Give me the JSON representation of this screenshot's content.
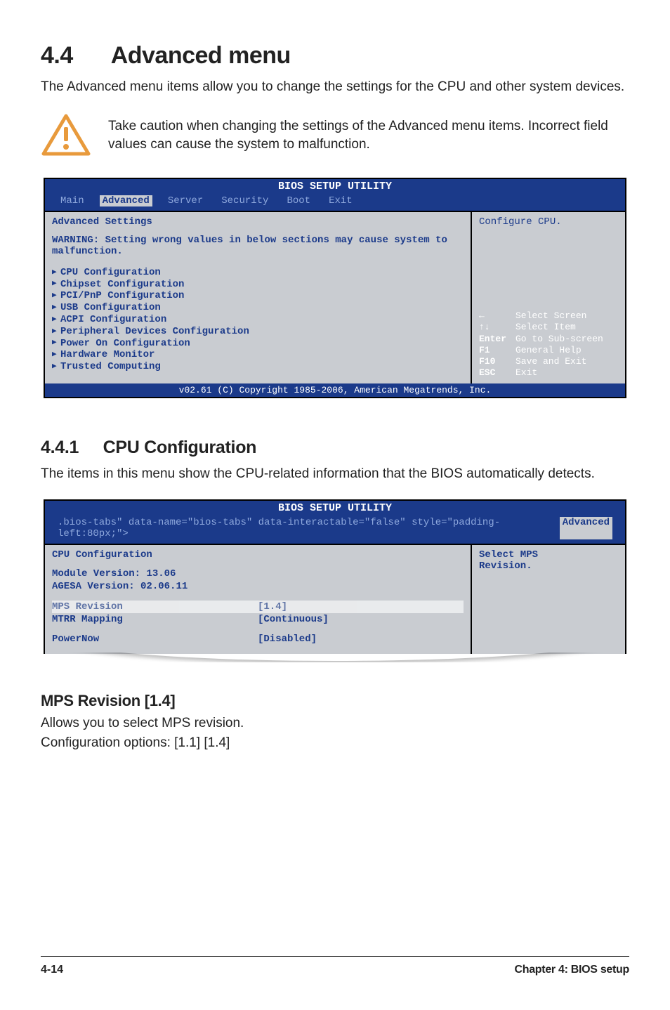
{
  "heading": {
    "num": "4.4",
    "title": "Advanced menu"
  },
  "intro": "The Advanced menu items allow you to change the settings for the CPU and other system devices.",
  "caution": "Take caution when changing the settings of the Advanced menu items. Incorrect field values can cause the system to malfunction.",
  "bios1": {
    "title": "BIOS SETUP UTILITY",
    "tabs": [
      "Main",
      "Advanced",
      "Server",
      "Security",
      "Boot",
      "Exit"
    ],
    "section_title": "Advanced Settings",
    "warning": "WARNING: Setting wrong values in below sections may cause system to malfunction.",
    "items": [
      "CPU Configuration",
      "Chipset Configuration",
      "PCI/PnP Configuration",
      "USB Configuration",
      "ACPI Configuration",
      "Peripheral Devices Configuration",
      "Power On Configuration",
      "Hardware Monitor",
      "Trusted Computing"
    ],
    "help_top": "Configure CPU.",
    "nav": [
      {
        "key": "←",
        "label": "Select Screen"
      },
      {
        "key": "↑↓",
        "label": "Select Item"
      },
      {
        "key": "Enter",
        "label": "Go to Sub-screen"
      },
      {
        "key": "F1",
        "label": "General Help"
      },
      {
        "key": "F10",
        "label": "Save and Exit"
      },
      {
        "key": "ESC",
        "label": "Exit"
      }
    ],
    "footer": "v02.61 (C) Copyright 1985-2006, American Megatrends, Inc."
  },
  "sub": {
    "num": "4.4.1",
    "title": "CPU Configuration"
  },
  "sub_intro": "The items in this menu show the CPU-related information that the BIOS automatically detects.",
  "bios2": {
    "title": "BIOS SETUP UTILITY",
    "tab": "Advanced",
    "section_title": "CPU Configuration",
    "module_ver_label": "Module Version:",
    "module_ver": "13.06",
    "agesa_ver_label": "AGESA Version:",
    "agesa_ver": "02.06.11",
    "rows": [
      {
        "name": "MPS Revision",
        "value": "[1.4]",
        "selected": true
      },
      {
        "name": "MTRR Mapping",
        "value": "[Continuous]",
        "selected": false
      },
      {
        "name": "PowerNow",
        "value": "[Disabled]",
        "selected": false
      }
    ],
    "help_top_line1": "Select MPS",
    "help_top_line2": "Revision."
  },
  "h3": "MPS Revision [1.4]",
  "mps_line1": "Allows you to select MPS revision.",
  "mps_line2": "Configuration options: [1.1] [1.4]",
  "footer": {
    "left": "4-14",
    "right": "Chapter 4: BIOS setup"
  }
}
